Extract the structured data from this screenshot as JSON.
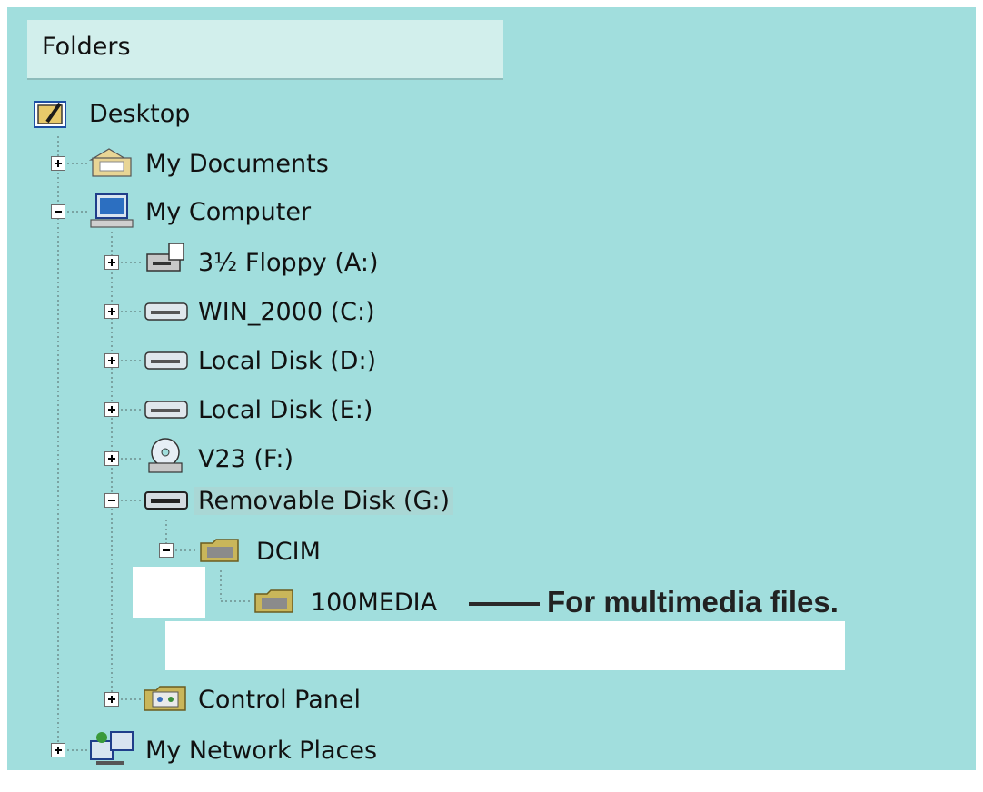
{
  "header": {
    "title": "Folders"
  },
  "tree": {
    "desktop": "Desktop",
    "my_documents": "My Documents",
    "my_computer": "My Computer",
    "floppy": "3½ Floppy (A:)",
    "win2000": "WIN_2000 (C:)",
    "local_d": "Local Disk (D:)",
    "local_e": "Local Disk (E:)",
    "v23": "V23 (F:)",
    "removable": "Removable Disk (G:)",
    "dcim": "DCIM",
    "media": "100MEDIA",
    "control_panel": "Control Panel",
    "network": "My Network Places"
  },
  "annotation": {
    "text": "For multimedia files."
  },
  "colors": {
    "background": "#a1dedd",
    "header": "#d2efec",
    "folder": "#c9b65a",
    "drive": "#9aa9b4"
  }
}
